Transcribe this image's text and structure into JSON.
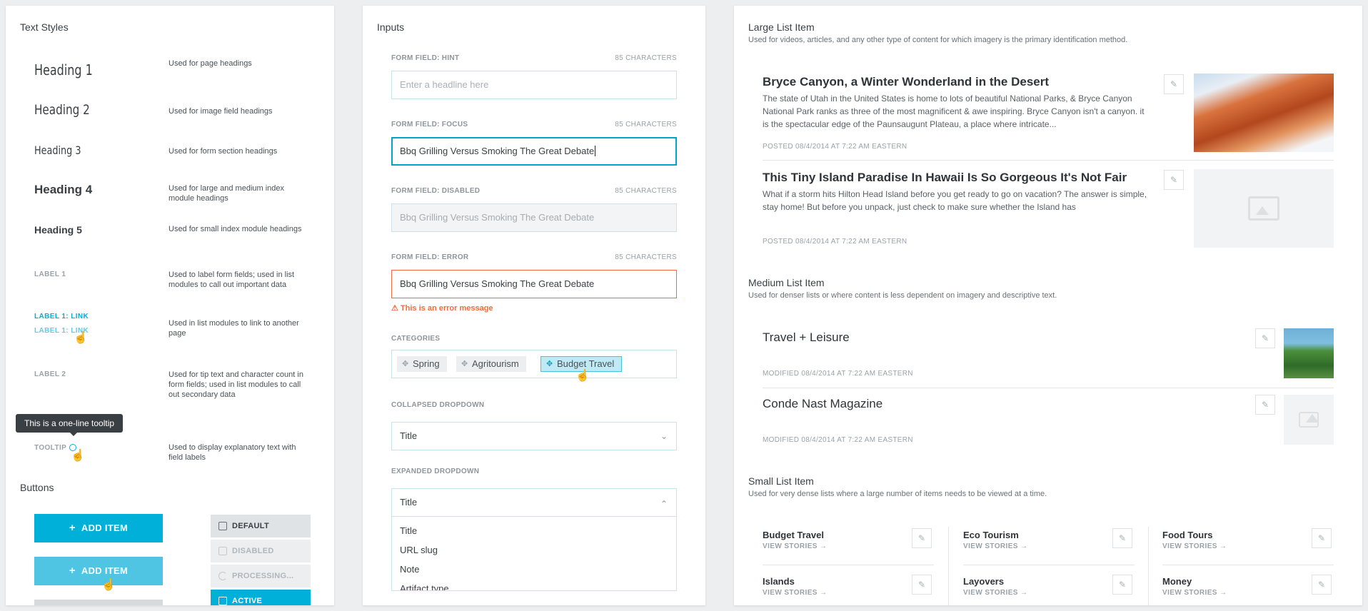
{
  "text_styles": {
    "title": "Text Styles",
    "rows": [
      {
        "sample": "Heading 1",
        "desc": "Used for page headings"
      },
      {
        "sample": "Heading 2",
        "desc": "Used for image field headings"
      },
      {
        "sample": "Heading 3",
        "desc": "Used for form section headings"
      },
      {
        "sample": "Heading 4",
        "desc": "Used for large and medium index module headings"
      },
      {
        "sample": "Heading 5",
        "desc": "Used for small index module headings"
      },
      {
        "sample": "LABEL 1",
        "desc": "Used to label form fields; used in list modules to call out important data"
      },
      {
        "sample": "LABEL 1: LINK",
        "sample2": "LABEL 1: LINK",
        "desc": "Used in list modules to link to another page"
      },
      {
        "sample": "LABEL 2",
        "desc": "Used for tip text and character count in form fields; used in list modules to call out secondary data"
      },
      {
        "sample": "TOOLTIP",
        "desc": "Used to display explanatory text with field labels"
      }
    ],
    "tooltip_text": "This is a one-line tooltip"
  },
  "buttons": {
    "title": "Buttons",
    "add_item": "ADD ITEM",
    "add_item_hover": "ADD ITEM",
    "small": [
      {
        "label": "DEFAULT"
      },
      {
        "label": "DISABLED"
      },
      {
        "label": "PROCESSING..."
      },
      {
        "label": "ACTIVE"
      }
    ]
  },
  "inputs": {
    "title": "Inputs",
    "hint": {
      "label": "FORM FIELD: HINT",
      "count": "85 CHARACTERS",
      "placeholder": "Enter a headline here"
    },
    "focus": {
      "label": "FORM FIELD: FOCUS",
      "count": "85 CHARACTERS",
      "value": "Bbq Grilling Versus Smoking The Great Debate"
    },
    "disabled": {
      "label": "FORM FIELD: DISABLED",
      "count": "85 CHARACTERS",
      "value": "Bbq Grilling Versus Smoking The Great Debate"
    },
    "error": {
      "label": "FORM FIELD: ERROR",
      "count": "85 CHARACTERS",
      "value": "Bbq Grilling Versus Smoking The Great Debate",
      "message": "This is an error message"
    },
    "categories": {
      "label": "CATEGORIES",
      "chips": [
        "Spring",
        "Agritourism",
        "Budget Travel"
      ]
    },
    "collapsed": {
      "label": "COLLAPSED DROPDOWN",
      "value": "Title"
    },
    "expanded": {
      "label": "EXPANDED DROPDOWN",
      "value": "Title",
      "options": [
        "Title",
        "URL slug",
        "Note",
        "Artifact type"
      ]
    }
  },
  "lists": {
    "large": {
      "title": "Large List Item",
      "desc": "Used for videos, articles, and any other type of content for which imagery is the primary identification method.",
      "items": [
        {
          "title": "Bryce Canyon, a Winter Wonderland in the Desert",
          "body": "The state of Utah in the United States is home to lots of beautiful National Parks, & Bryce Canyon National Park ranks as three of the most magnificent & awe inspiring. Bryce Canyon isn't a canyon. it is the spectacular edge of the Paunsaugunt Plateau, a place where intricate...",
          "posted": "POSTED 08/4/2014 AT 7:22 AM EASTERN"
        },
        {
          "title": "This Tiny Island Paradise In Hawaii Is So Gorgeous It's Not Fair",
          "body": "What if a storm hits Hilton Head Island before you get ready to go on vacation? The answer is simple, stay home! But before you unpack, just check to make sure whether the Island has",
          "posted": "POSTED 08/4/2014 AT 7:22 AM EASTERN"
        }
      ]
    },
    "medium": {
      "title": "Medium List Item",
      "desc": "Used for denser lists or where content is less dependent on imagery and descriptive text.",
      "items": [
        {
          "title": "Travel + Leisure",
          "modified": "MODIFIED 08/4/2014 AT 7:22 AM EASTERN"
        },
        {
          "title": "Conde Nast Magazine",
          "modified": "MODIFIED 08/4/2014 AT 7:22 AM EASTERN"
        }
      ]
    },
    "small": {
      "title": "Small List Item",
      "desc": "Used for very dense lists where a large number of items needs to be viewed at a time.",
      "link": "VIEW STORIES",
      "items": [
        "Budget Travel",
        "Eco Tourism",
        "Food Tours",
        "Islands",
        "Layovers",
        "Money"
      ]
    }
  },
  "colors": {
    "accent": "#00b0d8",
    "accent_hover": "#4fc5e3",
    "error": "#f06b3f"
  }
}
